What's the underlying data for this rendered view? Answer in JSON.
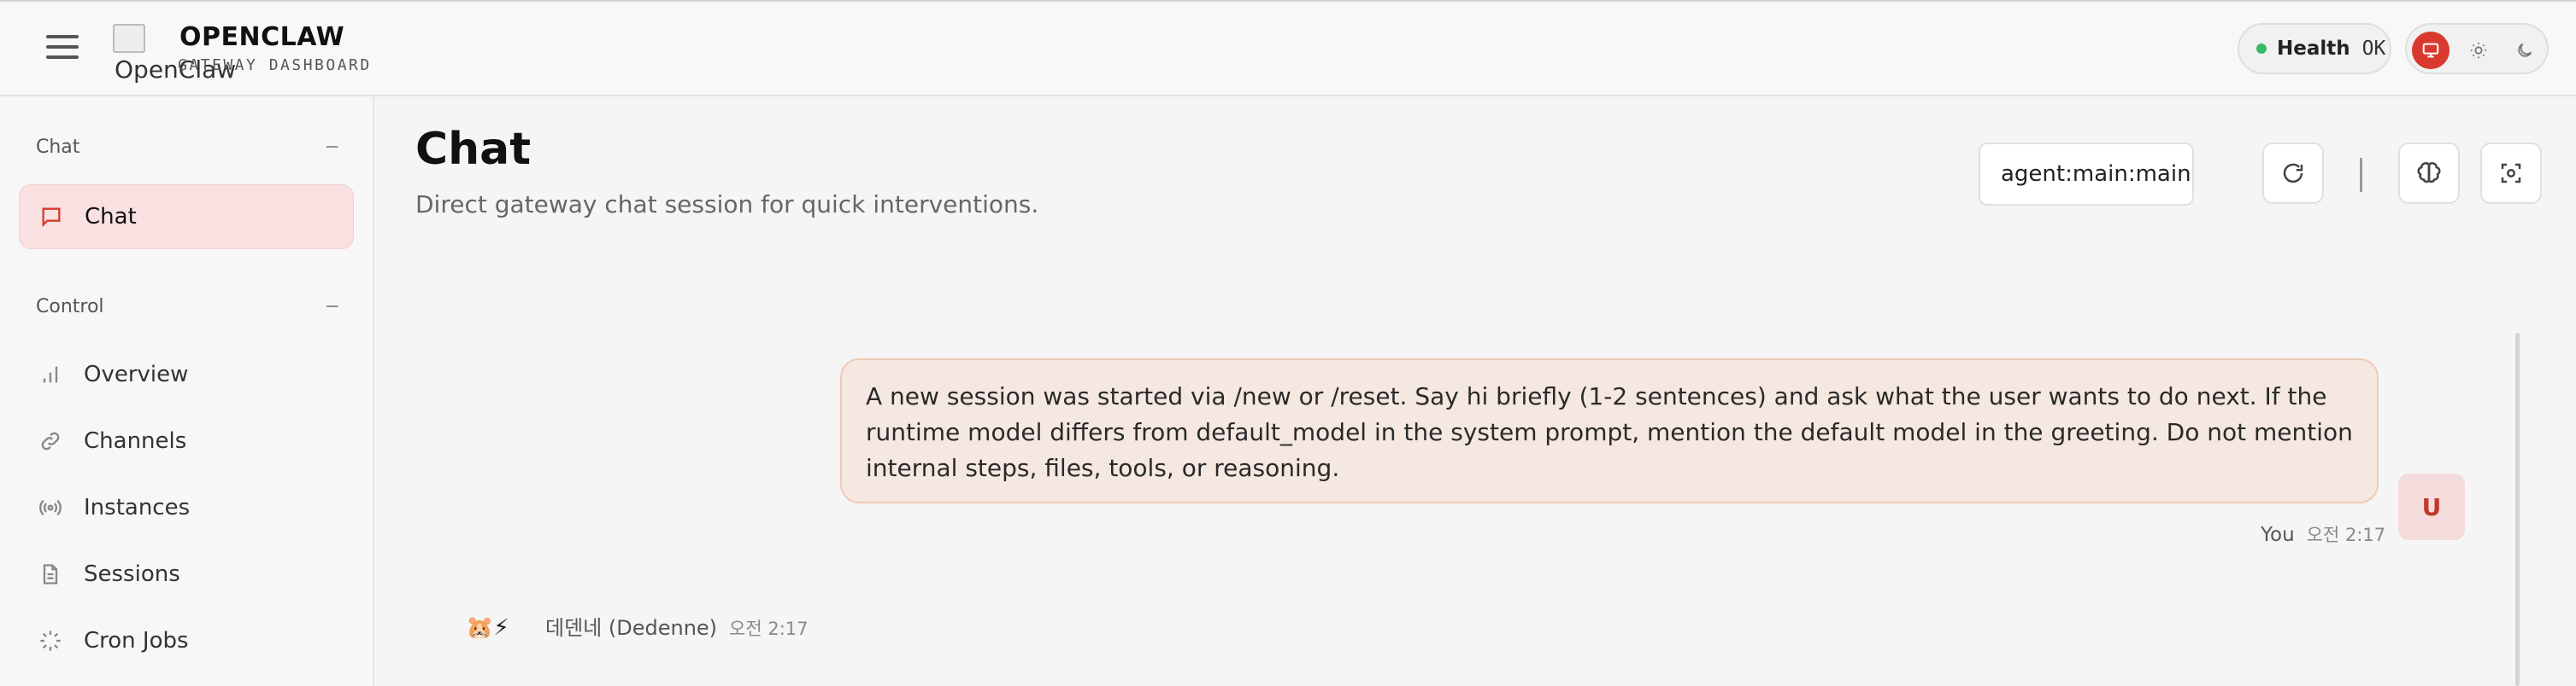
{
  "topbar": {
    "logo_alt": "OpenClaw",
    "brand_title": "OPENCLAW",
    "brand_subtitle": "GATEWAY DASHBOARD",
    "health_label": "Health",
    "health_status": "OK",
    "health_color": "#3ab86a",
    "theme_options": [
      "monitor-icon",
      "sun-icon",
      "moon-icon"
    ],
    "accent_color": "#d93a30"
  },
  "sidebar": {
    "sections": [
      {
        "title": "Chat",
        "collapse": "−",
        "items": [
          {
            "label": "Chat",
            "icon": "message-icon",
            "active": true
          }
        ]
      },
      {
        "title": "Control",
        "collapse": "−",
        "items": [
          {
            "label": "Overview",
            "icon": "bar-chart-icon"
          },
          {
            "label": "Channels",
            "icon": "link-icon"
          },
          {
            "label": "Instances",
            "icon": "radio-icon"
          },
          {
            "label": "Sessions",
            "icon": "file-icon"
          },
          {
            "label": "Cron Jobs",
            "icon": "loader-icon"
          }
        ]
      }
    ]
  },
  "main": {
    "title": "Chat",
    "subtitle": "Direct gateway chat session for quick interventions.",
    "session_value": "agent:main:main",
    "toolbar_icons": [
      "refresh-icon",
      "brain-icon",
      "focus-icon"
    ]
  },
  "messages": [
    {
      "role": "user",
      "text": "A new session was started via /new or /reset. Say hi briefly (1-2 sentences) and ask what the user wants to do next. If the runtime model differs from default_model in the system prompt, mention the default model in the greeting. Do not mention internal steps, files, tools, or reasoning.",
      "sender": "You",
      "time": "오전 2:17",
      "avatar": "U"
    },
    {
      "role": "assistant",
      "emoji": "🐹⚡",
      "sender": "데덴네 (Dedenne)",
      "time": "오전 2:17"
    }
  ]
}
